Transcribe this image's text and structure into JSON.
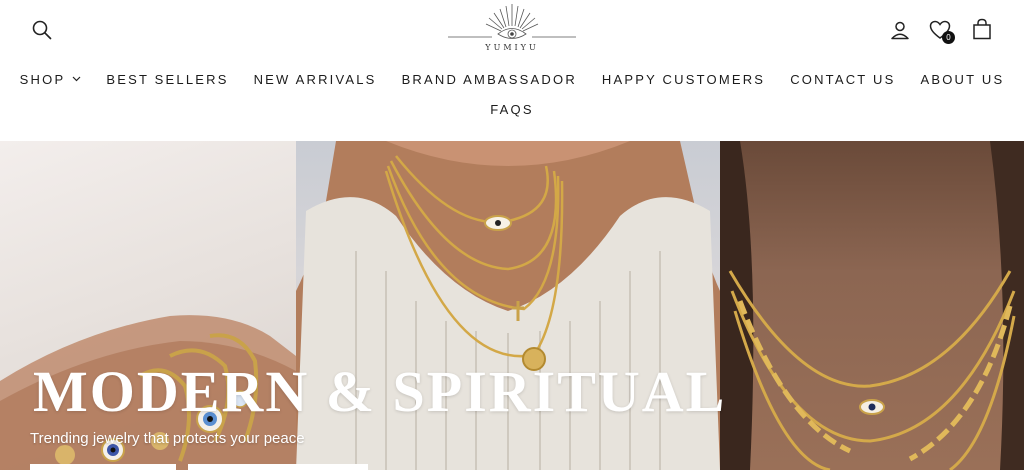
{
  "header": {
    "logo": {
      "text": "YUMIYU"
    },
    "icons": {
      "search": "search-icon",
      "account": "user-icon",
      "wishlist": "heart-icon",
      "cart": "shopping-bag-icon"
    },
    "wishlist_count": "0"
  },
  "nav": {
    "items": [
      {
        "label": "SHOP",
        "has_dropdown": true
      },
      {
        "label": "BEST SELLERS"
      },
      {
        "label": "NEW ARRIVALS"
      },
      {
        "label": "BRAND AMBASSADOR"
      },
      {
        "label": "HAPPY CUSTOMERS"
      },
      {
        "label": "CONTACT US"
      },
      {
        "label": "ABOUT US"
      },
      {
        "label": "FAQS"
      }
    ]
  },
  "hero": {
    "title": "MODERN & SPIRITUAL",
    "subtitle": "Trending jewelry that protects your peace",
    "images": [
      "bracelets-evil-eye-photo",
      "layered-necklaces-tank-top-photo",
      "gold-chain-necklaces-photo"
    ]
  },
  "colors": {
    "text": "#1c1c1c",
    "background": "#ffffff",
    "gold": "#c9a24a",
    "hero_text": "#ffffff"
  }
}
